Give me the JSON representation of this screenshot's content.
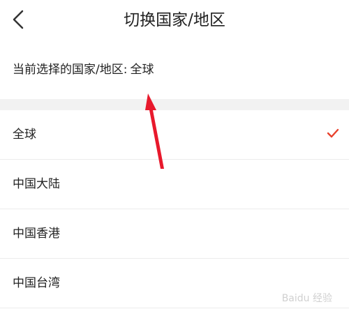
{
  "header": {
    "title": "切换国家/地区",
    "back_icon": "chevron-left-icon"
  },
  "current": {
    "label": "当前选择的国家/地区:",
    "value": "全球"
  },
  "regions": [
    {
      "label": "全球",
      "selected": true
    },
    {
      "label": "中国大陆",
      "selected": false
    },
    {
      "label": "中国香港",
      "selected": false
    },
    {
      "label": "中国台湾",
      "selected": false
    }
  ],
  "watermark": "Baidu 经验",
  "colors": {
    "accent": "#e8412c",
    "arrow": "#e8192c",
    "divider": "#f2f2f2"
  }
}
